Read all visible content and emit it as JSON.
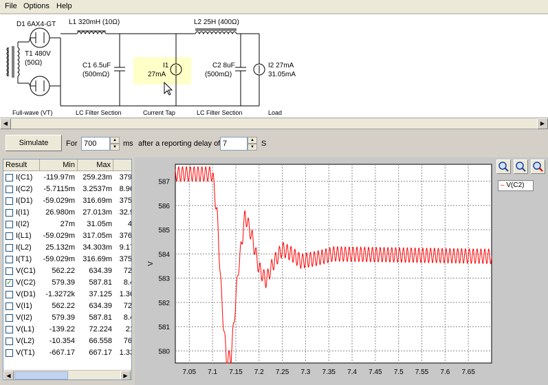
{
  "menu": [
    "File",
    "Options",
    "Help"
  ],
  "schematic": {
    "labels": {
      "d1": "D1 6AX4-GT",
      "t1": "T1 480V",
      "t1_res": "(50Ω)",
      "l1": "L1 320mH (10Ω)",
      "l2": "L2 25H (400Ω)",
      "c1": "C1 6.5uF",
      "c1_res": "(500mΩ)",
      "i1": "I1",
      "i1_val": "27mA",
      "c2": "C2 8uF",
      "c2_res": "(500mΩ)",
      "i2": "I2 27mA",
      "i2_val": "31.05mA"
    },
    "captions": [
      "Full-wave (VT)",
      "LC Filter Section",
      "Current Tap",
      "LC Filter Section",
      "Load"
    ]
  },
  "toolbar": {
    "simulate_label": "Simulate",
    "for_label": "For",
    "duration_value": "700",
    "ms_label": "ms",
    "delay_label": "after a reporting delay of",
    "delay_value": "7",
    "s_label": "S"
  },
  "results": {
    "headers": [
      "Result",
      "Min",
      "Max",
      ""
    ],
    "rows": [
      {
        "name": "I(C1)",
        "min": "-119.97m",
        "max": "259.23m",
        "extra": "379.",
        "checked": false
      },
      {
        "name": "I(C2)",
        "min": "-5.7115m",
        "max": "3.2537m",
        "extra": "8.96",
        "checked": false
      },
      {
        "name": "I(D1)",
        "min": "-59.029m",
        "max": "316.69m",
        "extra": "375.",
        "checked": false
      },
      {
        "name": "I(I1)",
        "min": "26.980m",
        "max": "27.013m",
        "extra": "32.9",
        "checked": false
      },
      {
        "name": "I(I2)",
        "min": "27m",
        "max": "31.05m",
        "extra": "4.",
        "checked": false
      },
      {
        "name": "I(L1)",
        "min": "-59.029m",
        "max": "317.05m",
        "extra": "376.",
        "checked": false
      },
      {
        "name": "I(L2)",
        "min": "25.132m",
        "max": "34.303m",
        "extra": "9.17",
        "checked": false
      },
      {
        "name": "I(T1)",
        "min": "-59.029m",
        "max": "316.69m",
        "extra": "375.",
        "checked": false
      },
      {
        "name": "V(C1)",
        "min": "562.22",
        "max": "634.39",
        "extra": "72.",
        "checked": false
      },
      {
        "name": "V(C2)",
        "min": "579.39",
        "max": "587.81",
        "extra": "8.4",
        "checked": true
      },
      {
        "name": "V(D1)",
        "min": "-1.3272k",
        "max": "37.125",
        "extra": "1.36",
        "checked": false
      },
      {
        "name": "V(I1)",
        "min": "562.22",
        "max": "634.39",
        "extra": "72.",
        "checked": false
      },
      {
        "name": "V(I2)",
        "min": "579.39",
        "max": "587.81",
        "extra": "8.4",
        "checked": false
      },
      {
        "name": "V(L1)",
        "min": "-139.22",
        "max": "72.224",
        "extra": "21",
        "checked": false
      },
      {
        "name": "V(L2)",
        "min": "-10.354",
        "max": "66.558",
        "extra": "76.",
        "checked": false
      },
      {
        "name": "V(T1)",
        "min": "-667.17",
        "max": "667.17",
        "extra": "1.33",
        "checked": false
      }
    ]
  },
  "chart_data": {
    "type": "line",
    "title": "",
    "xlabel": "",
    "ylabel": "V",
    "xlim": [
      7.02,
      7.7
    ],
    "ylim": [
      579.5,
      587.7
    ],
    "xticks": [
      "7.05",
      "7.1",
      "7.15",
      "7.2",
      "7.25",
      "7.3",
      "7.35",
      "7.4",
      "7.45",
      "7.5",
      "7.55",
      "7.6",
      "7.65"
    ],
    "yticks": [
      "580",
      "581",
      "582",
      "583",
      "584",
      "585",
      "586",
      "587"
    ],
    "grid": true,
    "legend": "top-right",
    "series": [
      {
        "name": "V(C2)",
        "color": "#ff0000",
        "envelope": [
          {
            "t": 7.02,
            "v": 587.3
          },
          {
            "t": 7.1,
            "v": 587.3
          },
          {
            "t": 7.11,
            "v": 585.6
          },
          {
            "t": 7.12,
            "v": 582.0
          },
          {
            "t": 7.13,
            "v": 579.6
          },
          {
            "t": 7.14,
            "v": 579.8
          },
          {
            "t": 7.155,
            "v": 583.3
          },
          {
            "t": 7.17,
            "v": 585.6
          },
          {
            "t": 7.185,
            "v": 584.7
          },
          {
            "t": 7.2,
            "v": 583.4
          },
          {
            "t": 7.215,
            "v": 582.9
          },
          {
            "t": 7.23,
            "v": 583.6
          },
          {
            "t": 7.25,
            "v": 584.2
          },
          {
            "t": 7.27,
            "v": 584.0
          },
          {
            "t": 7.29,
            "v": 583.7
          },
          {
            "t": 7.32,
            "v": 583.8
          },
          {
            "t": 7.36,
            "v": 584.0
          },
          {
            "t": 7.7,
            "v": 583.9
          }
        ],
        "ripple_amplitude": 0.3
      }
    ]
  },
  "zoom_buttons": [
    "zoom-in-icon",
    "zoom-out-icon",
    "zoom-reset-icon"
  ]
}
